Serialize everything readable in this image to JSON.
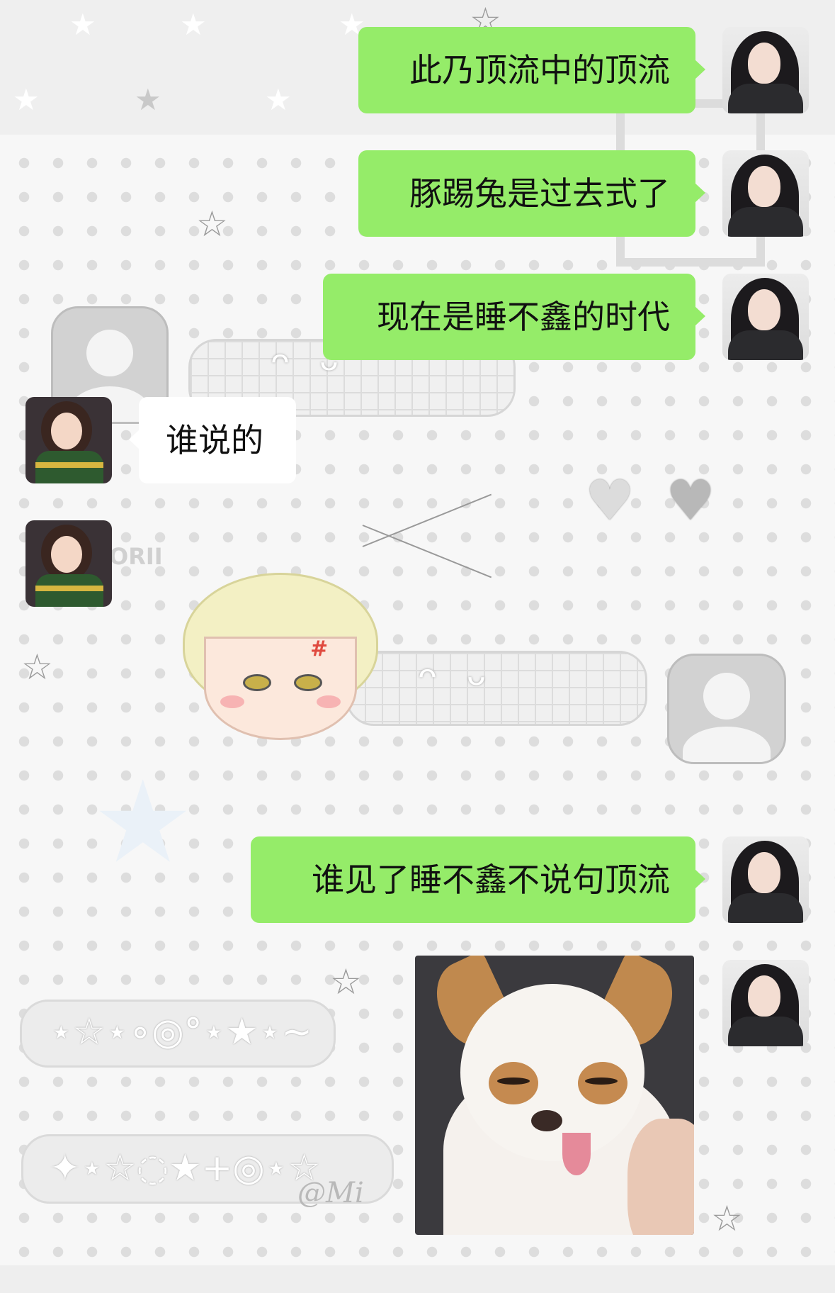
{
  "messages": [
    {
      "side": "right",
      "type": "text",
      "text": "此乃顶流中的顶流"
    },
    {
      "side": "right",
      "type": "text",
      "text": "豚踢兔是过去式了"
    },
    {
      "side": "right",
      "type": "text",
      "text": "现在是睡不鑫的时代"
    },
    {
      "side": "left",
      "type": "text",
      "text": "谁说的"
    },
    {
      "side": "left",
      "type": "sticker",
      "text": ""
    },
    {
      "side": "right",
      "type": "text",
      "text": "谁见了睡不鑫不说句顶流"
    },
    {
      "side": "right",
      "type": "image",
      "text": "chihuahua-photo"
    }
  ],
  "background": {
    "watermark": "@Mi",
    "sticker_text": "ORII",
    "anger_mark": "#"
  },
  "colors": {
    "bubble_green": "#95ec69",
    "bubble_white": "#ffffff",
    "background": "#f7f7f7"
  }
}
